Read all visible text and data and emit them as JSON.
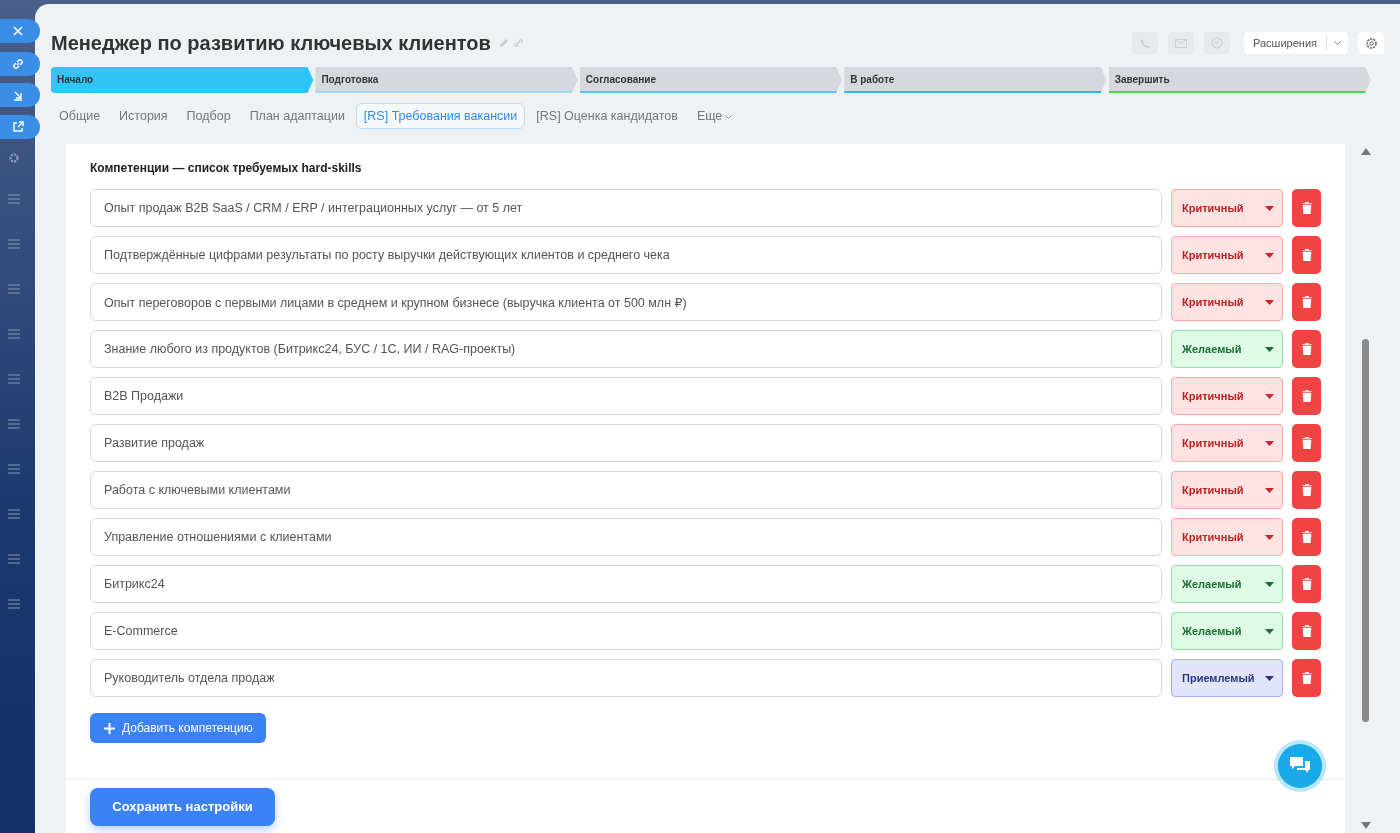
{
  "window": {
    "title": "Менеджер по развитию ключевых клиентов"
  },
  "header_actions": {
    "extensions_button": "Расширения"
  },
  "stages": [
    {
      "label": "Начало",
      "selected": true,
      "color": "#2fc6f6"
    },
    {
      "label": "Подготовка",
      "selected": false,
      "color": "#9fd8f5"
    },
    {
      "label": "Согласование",
      "selected": false,
      "color": "#55c8f2"
    },
    {
      "label": "В работе",
      "selected": false,
      "color": "#2fb7ee"
    },
    {
      "label": "Завершить",
      "selected": false,
      "color": "#4cd94c"
    }
  ],
  "tabs": [
    {
      "label": "Общие",
      "selected": false
    },
    {
      "label": "История",
      "selected": false
    },
    {
      "label": "Подбор",
      "selected": false
    },
    {
      "label": "План адаптации",
      "selected": false
    },
    {
      "label": "[RS] Требования вакансии",
      "selected": true
    },
    {
      "label": "[RS] Оценка кандидатов",
      "selected": false
    },
    {
      "label": "Еще",
      "selected": false,
      "kind": "more"
    }
  ],
  "section": {
    "title": "Компетенции — список требуемых hard-skills",
    "skills": [
      {
        "text": "Опыт продаж B2B SaaS / CRM / ERP / интеграционных услуг — от 5 лет",
        "priority": "Критичный",
        "kind": "critical"
      },
      {
        "text": "Подтверждённые цифрами результаты по росту выручки действующих клиентов и среднего чека",
        "priority": "Критичный",
        "kind": "critical"
      },
      {
        "text": "Опыт переговоров с первыми лицами в среднем и крупном бизнесе (выручка клиента от 500 млн ₽)",
        "priority": "Критичный",
        "kind": "critical"
      },
      {
        "text": "Знание любого из продуктов (Битрикс24, БУС / 1С, ИИ / RAG-проекты)",
        "priority": "Желаемый",
        "kind": "desired"
      },
      {
        "text": "B2B Продажи",
        "priority": "Критичный",
        "kind": "critical"
      },
      {
        "text": "Развитие продаж",
        "priority": "Критичный",
        "kind": "critical"
      },
      {
        "text": "Работа с ключевыми клиентами",
        "priority": "Критичный",
        "kind": "critical"
      },
      {
        "text": "Управление отношениями с клиентами",
        "priority": "Критичный",
        "kind": "critical"
      },
      {
        "text": "Битрикс24",
        "priority": "Желаемый",
        "kind": "desired"
      },
      {
        "text": "E-Commerce",
        "priority": "Желаемый",
        "kind": "desired"
      },
      {
        "text": "Руководитель отдела продаж",
        "priority": "Приемлемый",
        "kind": "acceptable"
      }
    ],
    "add_button": "Добавить компетенцию"
  },
  "footer": {
    "save_button": "Сохранить настройки"
  }
}
